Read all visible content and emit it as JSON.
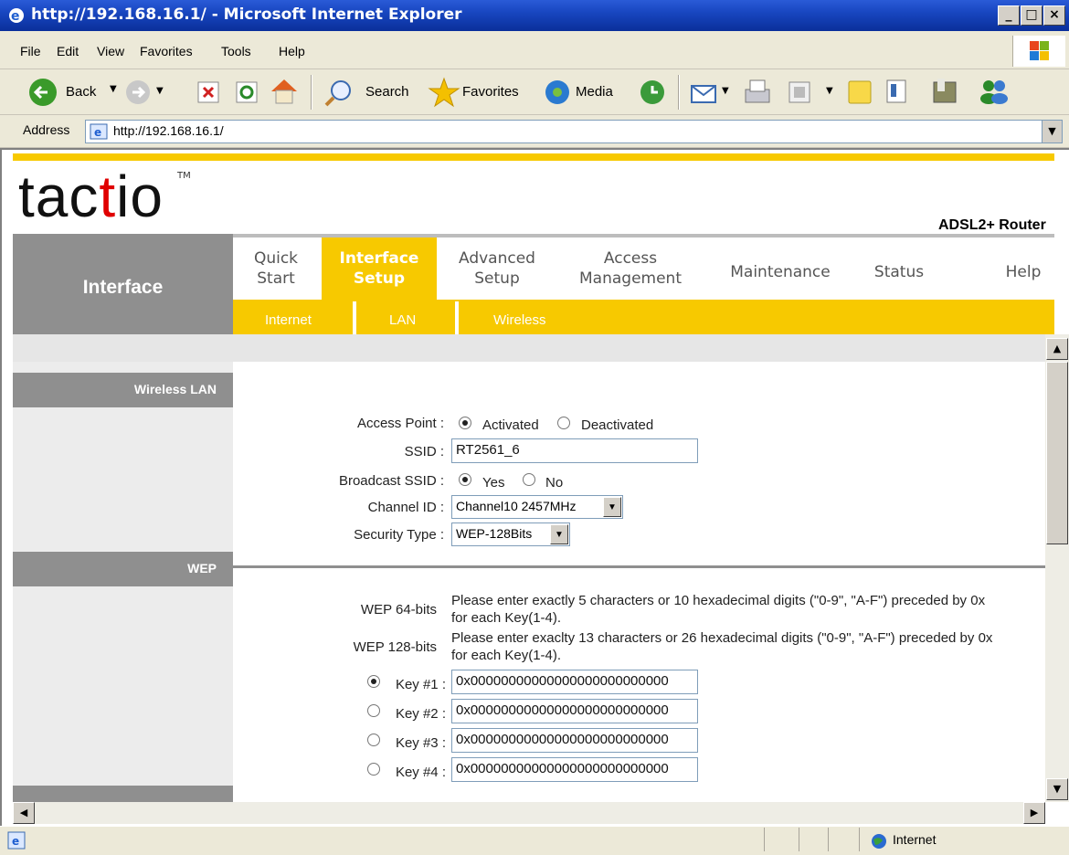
{
  "window": {
    "title": "http://192.168.16.1/ - Microsoft Internet Explorer"
  },
  "menu": [
    "File",
    "Edit",
    "View",
    "Favorites",
    "Tools",
    "Help"
  ],
  "toolbar": {
    "back": "Back",
    "search": "Search",
    "favorites": "Favorites",
    "media": "Media"
  },
  "address": {
    "label": "Address",
    "url": "http://192.168.16.1/"
  },
  "brand": {
    "logo_pre": "tac",
    "logo_t": "t",
    "logo_post": "io",
    "tm": "TM",
    "product": "ADSL2+ Router"
  },
  "sidebar": {
    "title": "Interface"
  },
  "nav": {
    "quick": [
      "Quick",
      "Start"
    ],
    "interface": [
      "Interface",
      "Setup"
    ],
    "advanced": [
      "Advanced",
      "Setup"
    ],
    "access": [
      "Access",
      "Management"
    ],
    "maintenance": "Maintenance",
    "status": "Status",
    "help": "Help"
  },
  "subnav": [
    "Internet",
    "LAN",
    "Wireless"
  ],
  "sections": {
    "wlan": "Wireless LAN",
    "wep": "WEP"
  },
  "form": {
    "access_point": {
      "label": "Access Point :",
      "opt1": "Activated",
      "opt2": "Deactivated"
    },
    "ssid": {
      "label": "SSID :",
      "value": "RT2561_6"
    },
    "broadcast": {
      "label": "Broadcast SSID :",
      "opt1": "Yes",
      "opt2": "No"
    },
    "channel": {
      "label": "Channel ID :",
      "value": "Channel10 2457MHz"
    },
    "security": {
      "label": "Security Type :",
      "value": "WEP-128Bits"
    }
  },
  "wep": {
    "w64_label": "WEP 64-bits",
    "w64_help1": "Please enter exactly 5 characters or 10 hexadecimal digits (\"0-9\", \"A-F\") preceded by 0x",
    "w64_help2": "for each Key(1-4).",
    "w128_label": "WEP 128-bits",
    "w128_help1": "Please enter exaclty 13 characters or 26 hexadecimal digits (\"0-9\", \"A-F\") preceded by 0x",
    "w128_help2": "for each Key(1-4).",
    "keys": [
      {
        "label": "Key #1 :",
        "value": "0x00000000000000000000000000"
      },
      {
        "label": "Key #2 :",
        "value": "0x00000000000000000000000000"
      },
      {
        "label": "Key #3 :",
        "value": "0x00000000000000000000000000"
      },
      {
        "label": "Key #4 :",
        "value": "0x00000000000000000000000000"
      }
    ]
  },
  "status": {
    "zone": "Internet"
  },
  "colors": {
    "accent_yellow": "#f7c900",
    "section_gray": "#8f8f8f",
    "logo_red": "#e00000"
  }
}
